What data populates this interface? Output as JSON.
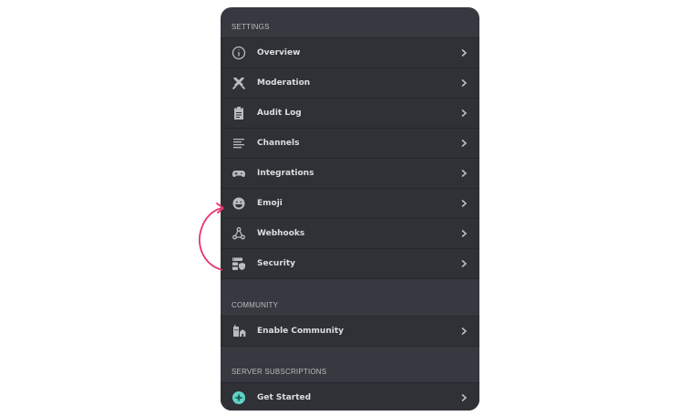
{
  "sections": {
    "settings": {
      "header": "SETTINGS",
      "items": [
        {
          "label": "Overview",
          "icon": "info-icon"
        },
        {
          "label": "Moderation",
          "icon": "swords-icon"
        },
        {
          "label": "Audit Log",
          "icon": "clipboard-icon"
        },
        {
          "label": "Channels",
          "icon": "list-icon"
        },
        {
          "label": "Integrations",
          "icon": "gamepad-icon"
        },
        {
          "label": "Emoji",
          "icon": "smile-icon"
        },
        {
          "label": "Webhooks",
          "icon": "webhook-icon"
        },
        {
          "label": "Security",
          "icon": "shield-server-icon"
        }
      ]
    },
    "community": {
      "header": "COMMUNITY",
      "items": [
        {
          "label": "Enable Community",
          "icon": "community-icon"
        }
      ]
    },
    "subscriptions": {
      "header": "SERVER SUBSCRIPTIONS",
      "items": [
        {
          "label": "Get Started",
          "icon": "subscription-gem-icon"
        }
      ]
    }
  },
  "colors": {
    "panel_bg": "#36393f",
    "row_bg": "#2f3136",
    "text": "#dcddde",
    "muted": "#b9bbbe",
    "annotation_arrow": "#e8336d",
    "gem": "#5fd3c3"
  }
}
